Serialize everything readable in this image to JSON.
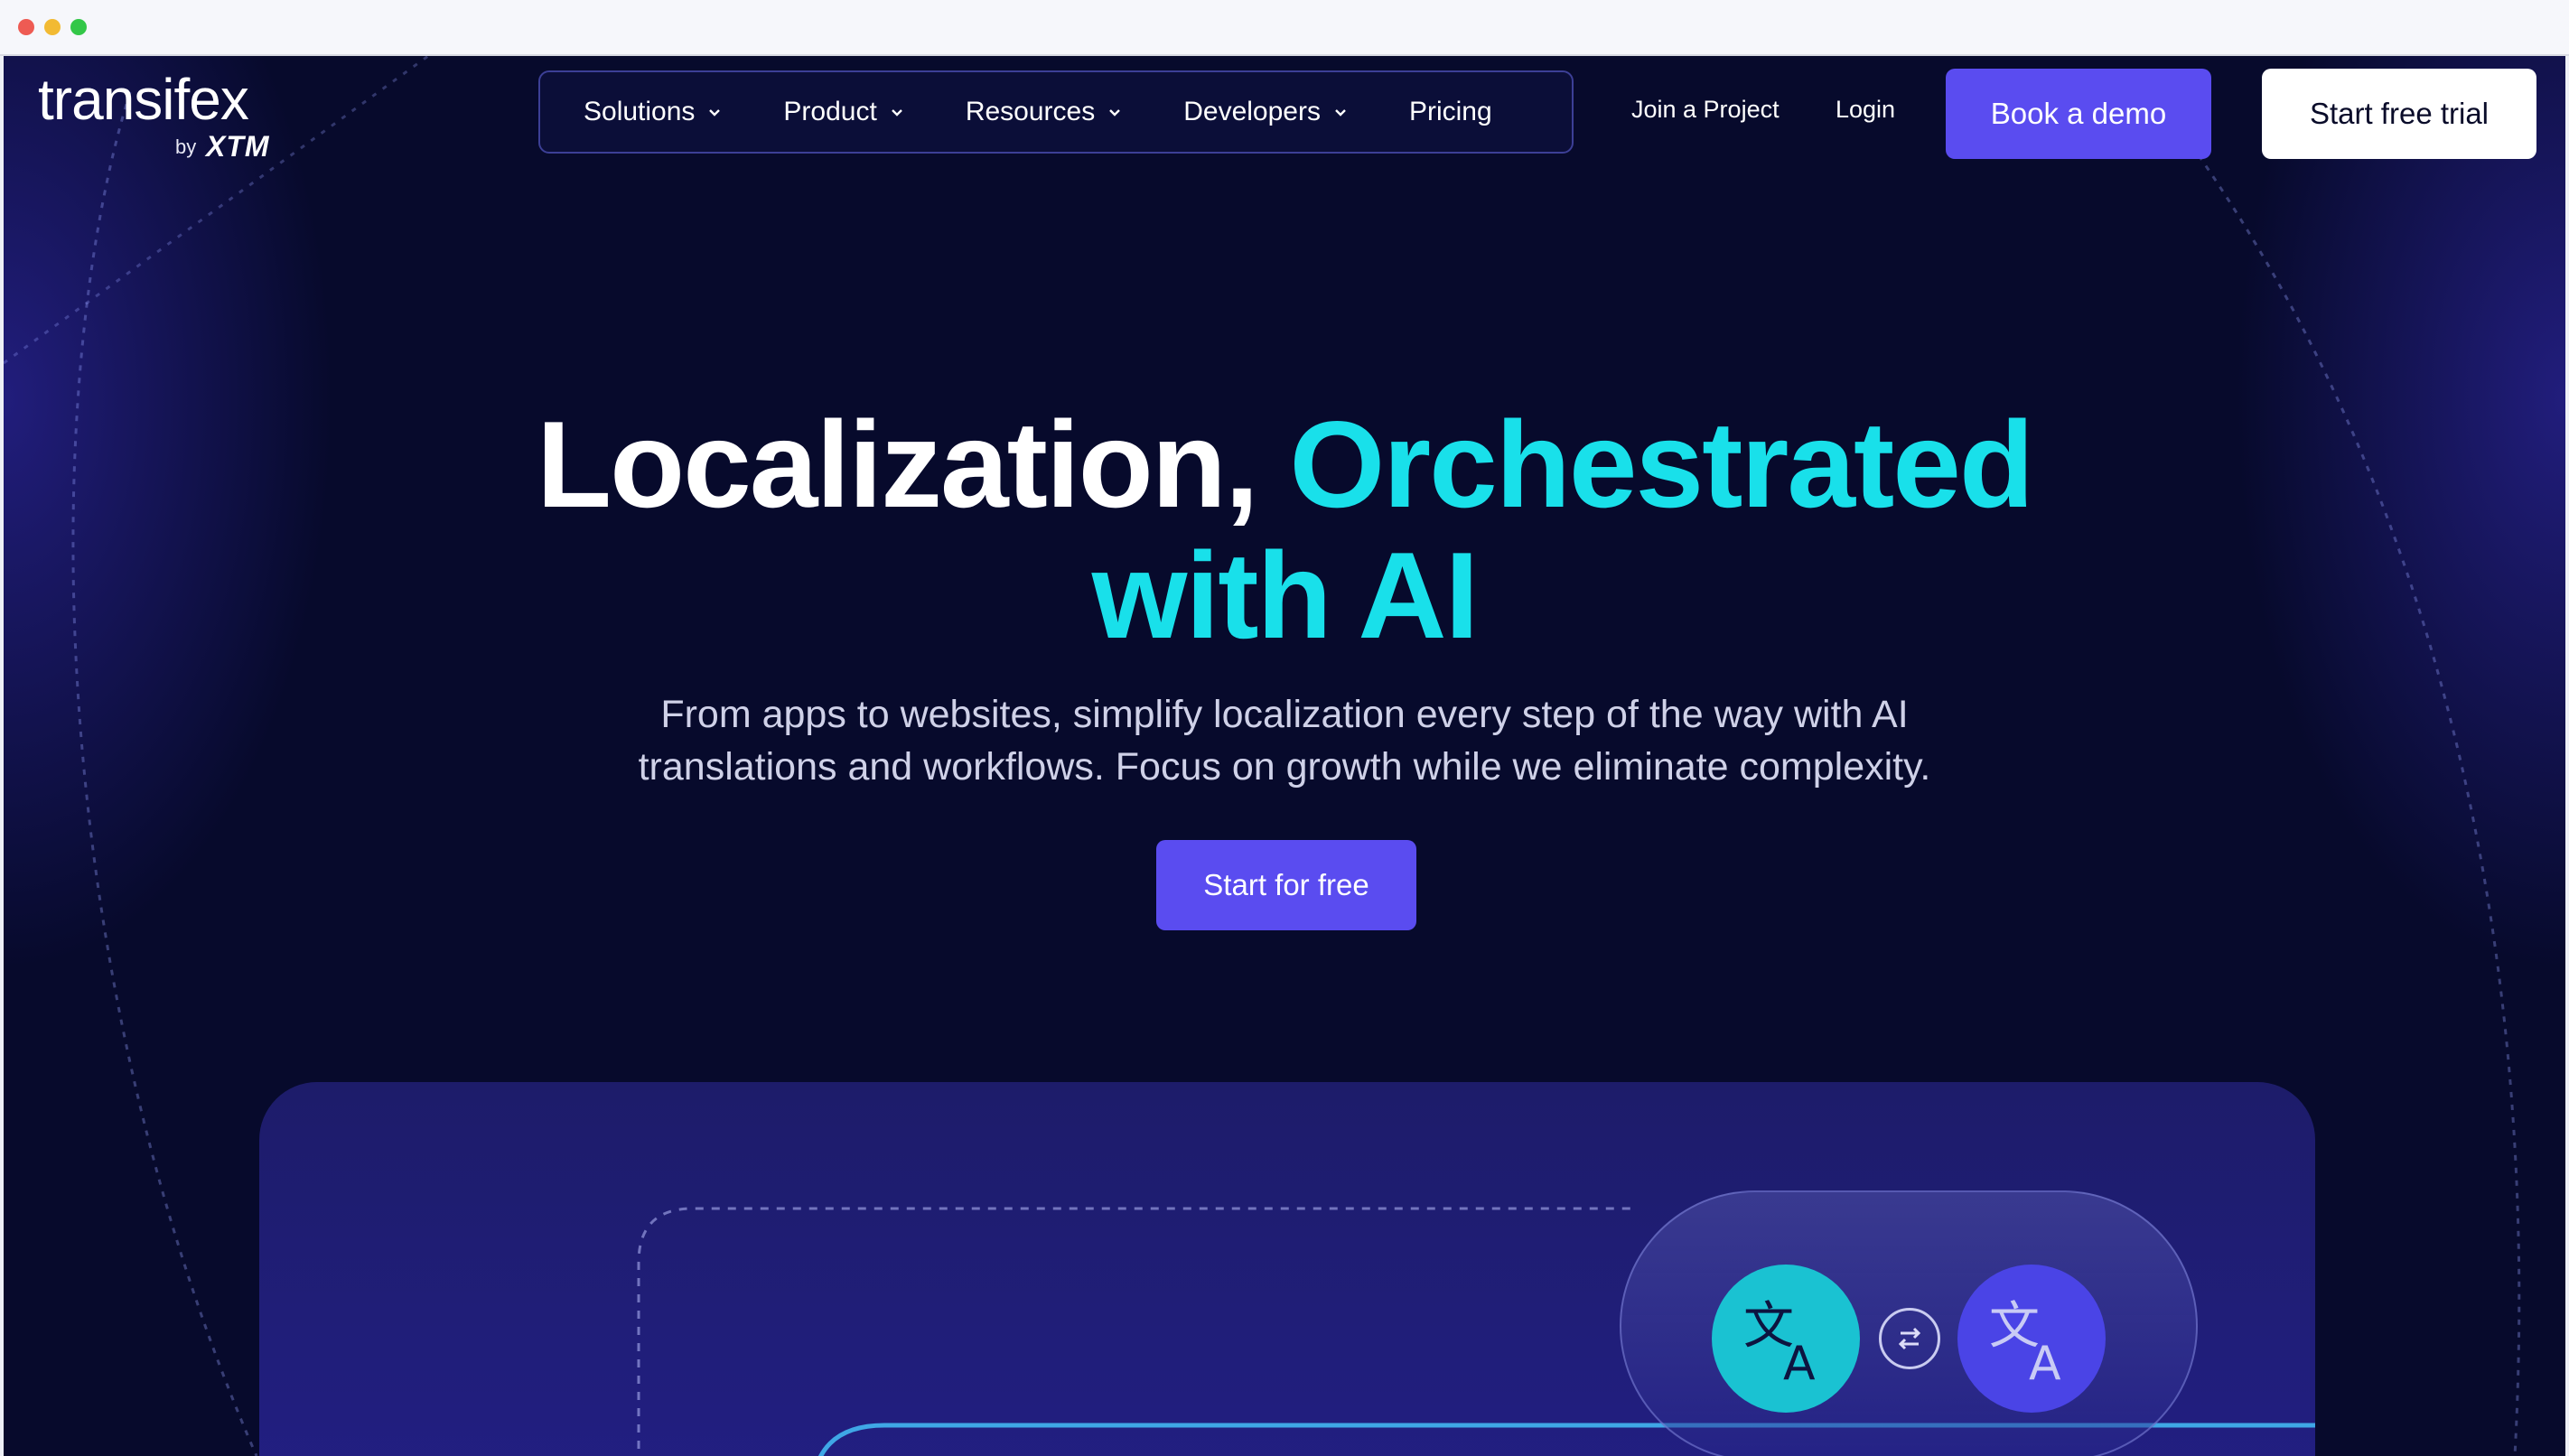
{
  "browser": {
    "traffic_lights": [
      "#ee5b53",
      "#f2ba33",
      "#33c748"
    ]
  },
  "header": {
    "logo": {
      "wordmark": "transifex",
      "by": "by",
      "brand": "XTM"
    },
    "nav": [
      {
        "label": "Solutions",
        "has_dropdown": true
      },
      {
        "label": "Product",
        "has_dropdown": true
      },
      {
        "label": "Resources",
        "has_dropdown": true
      },
      {
        "label": "Developers",
        "has_dropdown": true
      },
      {
        "label": "Pricing",
        "has_dropdown": false
      }
    ],
    "join_project": "Join a Project",
    "login": "Login",
    "book_demo": "Book a demo",
    "start_trial": "Start free trial"
  },
  "hero": {
    "headline_plain": "Localization,",
    "headline_accent_line1": "Orchestrated",
    "headline_accent_line2": "with AI",
    "subtitle_line1": "From apps to websites, simplify localization every step of the way with AI",
    "subtitle_line2": "translations and workflows. Focus on growth while we eliminate complexity.",
    "cta": "Start for free"
  },
  "visual": {
    "icons": [
      "translate-icon",
      "swap-icon",
      "translate-icon"
    ],
    "window_dots": [
      "#d9528d",
      "#d88a4f",
      "#1a94c9"
    ]
  },
  "colors": {
    "background": "#070a2c",
    "accent": "#19e0ea",
    "primary": "#5a4cf0",
    "panel": "#221f83"
  }
}
